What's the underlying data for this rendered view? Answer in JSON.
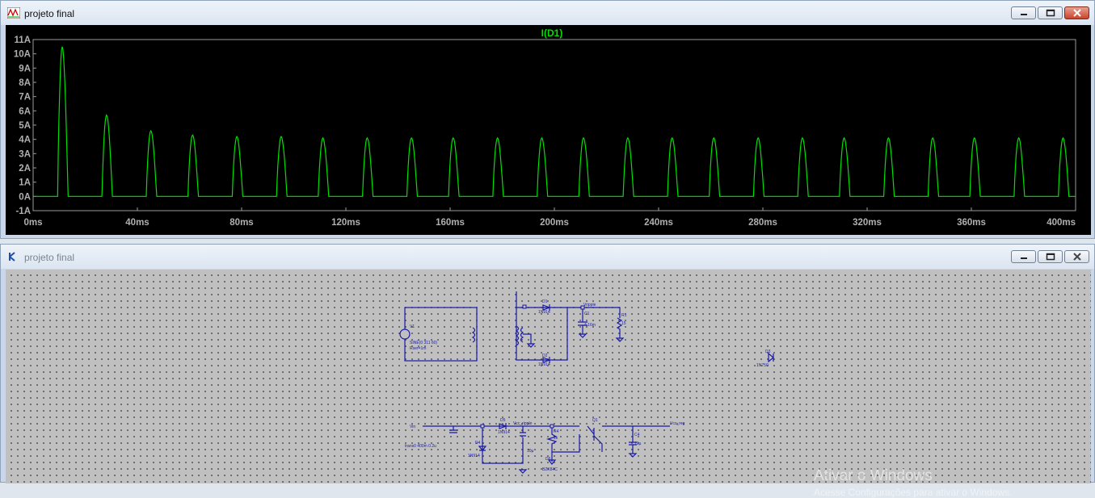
{
  "waveform_window": {
    "title": "projeto final",
    "controls": {
      "minimize": "minimize-icon",
      "maximize": "maximize-icon",
      "close": "close-icon"
    }
  },
  "schematic_window": {
    "title": "projeto final",
    "watermark": {
      "line1": "Ativar o Windows",
      "line2": "Acesse Configurações para ativar o Windows."
    }
  },
  "chart_data": {
    "type": "line",
    "title": "I(D1)",
    "xlabel": "",
    "ylabel": "",
    "xlim": [
      0,
      400
    ],
    "ylim": [
      -1,
      11
    ],
    "x_tick_labels": [
      "0ms",
      "40ms",
      "80ms",
      "120ms",
      "160ms",
      "200ms",
      "240ms",
      "280ms",
      "320ms",
      "360ms",
      "400ms"
    ],
    "y_tick_labels": [
      "11A",
      "10A",
      "9A",
      "8A",
      "7A",
      "6A",
      "5A",
      "4A",
      "3A",
      "2A",
      "1A",
      "0A",
      "-1A"
    ],
    "grid": false,
    "trace_color": "#00e000",
    "pulse_times_ms": [
      12,
      29,
      46,
      62,
      79,
      96,
      112,
      129,
      146,
      162,
      179,
      196,
      212,
      229,
      246,
      262,
      279,
      296,
      312,
      329,
      346,
      362,
      379,
      396
    ],
    "pulse_peaks_A": [
      10.5,
      5.7,
      4.6,
      4.3,
      4.2,
      4.2,
      4.1,
      4.1,
      4.1,
      4.1,
      4.1,
      4.1,
      4.1,
      4.1,
      4.1,
      4.1,
      4.1,
      4.1,
      4.1,
      4.1,
      4.1,
      4.1,
      4.1,
      4.1
    ],
    "baseline_A": 0
  }
}
